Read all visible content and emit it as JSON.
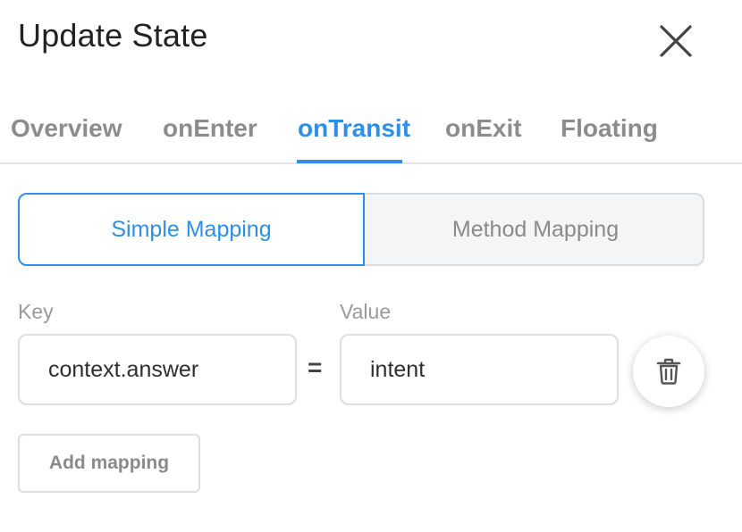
{
  "header": {
    "title": "Update State",
    "close_icon": "close-icon"
  },
  "tabs": [
    {
      "label": "Overview",
      "active": false
    },
    {
      "label": "onEnter",
      "active": false
    },
    {
      "label": "onTransit",
      "active": true
    },
    {
      "label": "onExit",
      "active": false
    },
    {
      "label": "Floating",
      "active": false
    }
  ],
  "mapping_mode": {
    "options": [
      "Simple Mapping",
      "Method Mapping"
    ],
    "selected": "Simple Mapping"
  },
  "fields": {
    "key_label": "Key",
    "value_label": "Value",
    "separator": "="
  },
  "mappings": [
    {
      "key": "context.answer",
      "value": "intent",
      "delete_icon": "trash-icon"
    }
  ],
  "actions": {
    "add_label": "Add mapping"
  },
  "colors": {
    "accent": "#2f8fe8",
    "muted_text": "#8c8c8c",
    "border": "#dedede"
  }
}
